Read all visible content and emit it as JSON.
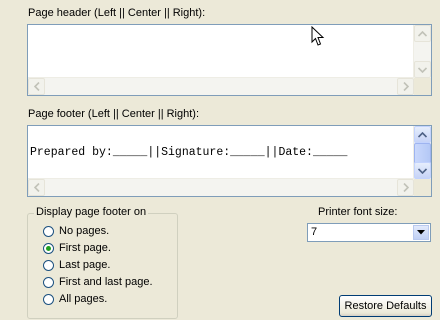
{
  "header": {
    "label": "Page header (Left || Center || Right):",
    "text": ""
  },
  "footer": {
    "label": "Page footer (Left || Center || Right):",
    "text": "Prepared by:_____||Signature:_____||Date:_____"
  },
  "display_footer": {
    "legend": "Display page footer on",
    "options": [
      "No pages.",
      "First page.",
      "Last page.",
      "First and last page.",
      "All pages."
    ],
    "selected": "First page."
  },
  "font_size": {
    "label": "Printer font size:",
    "value": "7"
  },
  "restore_button": {
    "label": "Restore Defaults"
  },
  "icons": {
    "cursor": "mouse-pointer-icon",
    "up": "up-arrow-icon",
    "down": "down-arrow-icon",
    "left": "left-arrow-icon",
    "right": "right-arrow-icon",
    "dropdown": "chevron-down-icon"
  },
  "colors": {
    "background": "#ece9d8",
    "field_border": "#7f9db9",
    "radio_dot": "#21a121"
  }
}
